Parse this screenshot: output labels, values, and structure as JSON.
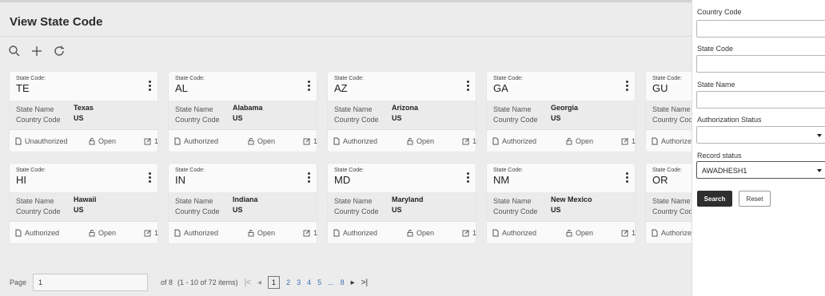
{
  "page": {
    "title": "View State Code"
  },
  "toolbar": {
    "icons": [
      "search-icon",
      "add-icon",
      "refresh-icon"
    ]
  },
  "card_labels": {
    "code_label": "State Code:",
    "name_label": "State Name",
    "country_label": "Country Code",
    "open_label": "Open"
  },
  "cards": [
    {
      "code": "TE",
      "name": "Texas",
      "country": "US",
      "status": "Unauthorized",
      "count": "1"
    },
    {
      "code": "AL",
      "name": "Alabama",
      "country": "US",
      "status": "Authorized",
      "count": "1"
    },
    {
      "code": "AZ",
      "name": "Arizona",
      "country": "US",
      "status": "Authorized",
      "count": "1"
    },
    {
      "code": "GA",
      "name": "Georgia",
      "country": "US",
      "status": "Authorized",
      "count": "1"
    },
    {
      "code": "GU",
      "name": "",
      "country": "",
      "status": "Authorized",
      "count": ""
    },
    {
      "code": "HI",
      "name": "Hawaii",
      "country": "US",
      "status": "Authorized",
      "count": "1"
    },
    {
      "code": "IN",
      "name": "Indiana",
      "country": "US",
      "status": "Authorized",
      "count": "1"
    },
    {
      "code": "MD",
      "name": "Maryland",
      "country": "US",
      "status": "Authorized",
      "count": "1"
    },
    {
      "code": "NM",
      "name": "New Mexico",
      "country": "US",
      "status": "Authorized",
      "count": "1"
    },
    {
      "code": "OR",
      "name": "",
      "country": "",
      "status": "Authorized",
      "count": ""
    }
  ],
  "pagination": {
    "page_label": "Page",
    "page_value": "1",
    "of_text": "of 8",
    "items_text": "(1 - 10 of 72 items)",
    "first": "|<",
    "prev": "◂",
    "pages": [
      "1",
      "2",
      "3",
      "4",
      "5",
      "...",
      "8"
    ],
    "next": "▸",
    "last": ">|"
  },
  "search_panel": {
    "country_code_label": "Country Code",
    "country_code_value": "",
    "state_code_label": "State Code",
    "state_code_value": "",
    "state_name_label": "State Name",
    "state_name_value": "",
    "auth_status_label": "Authorization Status",
    "auth_status_value": "",
    "record_status_label": "Record status",
    "record_status_value": "AWADHESH1",
    "search_button": "Search",
    "reset_button": "Reset"
  }
}
